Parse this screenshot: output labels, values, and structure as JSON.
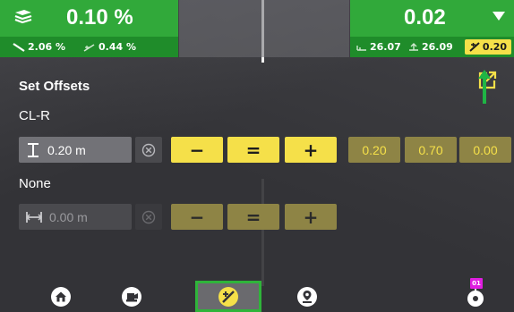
{
  "header": {
    "left": {
      "value": "0.10 %",
      "mode_icon": "layers-slope-icon",
      "cross_slope": "2.06 %",
      "secondary_slope": "0.44 %"
    },
    "right": {
      "value": "0.02",
      "target_left": "26.07",
      "target_right": "26.09",
      "offset_chip": "0.20"
    }
  },
  "panel": {
    "title": "Set Offsets"
  },
  "vertical_offset": {
    "label": "CL-R",
    "value": "0.20 m",
    "minus": "−",
    "equal": "=",
    "plus": "+",
    "presets": [
      "0.20",
      "0.70",
      "0.00"
    ]
  },
  "horizontal_offset": {
    "label": "None",
    "value": "0.00 m",
    "minus": "−",
    "equal": "=",
    "plus": "+"
  },
  "nav": {
    "items": [
      "home-icon",
      "machine-icon",
      "offset-icon",
      "map-pin-icon",
      "gps-device-icon"
    ],
    "badge": "01"
  },
  "colors": {
    "green": "#31a93a",
    "green_dark": "#1f8c2a",
    "yellow": "#f5e049",
    "yellow_dim": "#8e8445",
    "active_border": "#2fb43a"
  }
}
